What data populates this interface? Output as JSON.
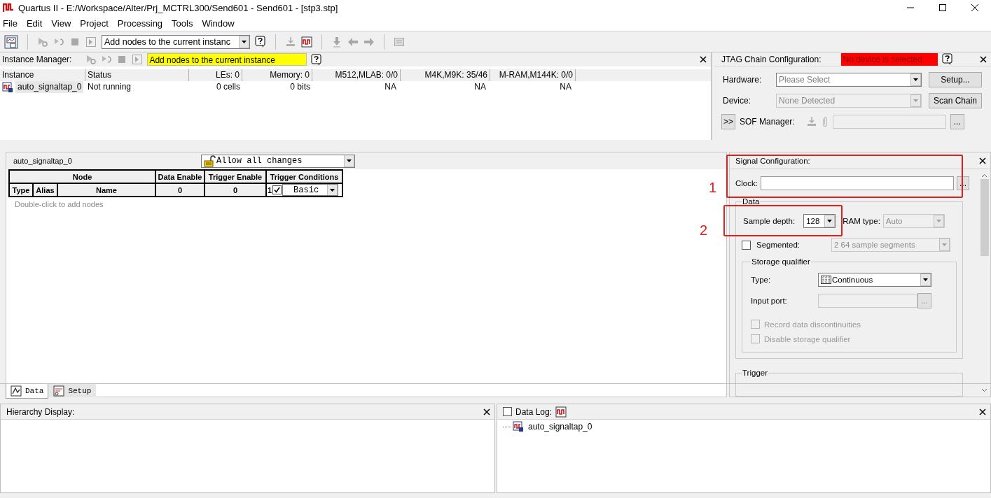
{
  "window": {
    "title": "Quartus II - E:/Workspace/Alter/Prj_MCTRL300/Send601 - Send601 - [stp3.stp]"
  },
  "menu": [
    "File",
    "Edit",
    "View",
    "Project",
    "Processing",
    "Tools",
    "Window"
  ],
  "toolbar": {
    "instance_combo": "Add nodes to the current instanc"
  },
  "instance_manager": {
    "label": "Instance Manager:",
    "status_message": "Add nodes to the current instance",
    "columns": [
      "Instance",
      "Status",
      "LEs: 0",
      "Memory: 0",
      "M512,MLAB: 0/0",
      "M4K,M9K: 35/46",
      "M-RAM,M144K: 0/0"
    ],
    "rows": [
      {
        "cells": [
          "auto_signaltap_0",
          "Not running",
          "0 cells",
          "0 bits",
          "NA",
          "NA",
          "NA"
        ],
        "selected": true
      }
    ]
  },
  "jtag": {
    "label": "JTAG Chain Configuration:",
    "status_message": "No device is selected",
    "hardware_label": "Hardware:",
    "hardware_value": "Please Select",
    "setup_button": "Setup...",
    "device_label": "Device:",
    "device_value": "None Detected",
    "scan_button": "Scan Chain",
    "expand_button": ">>",
    "sof_label": "SOF Manager:",
    "browse_button": "..."
  },
  "node_editor": {
    "instance": "auto_signaltap_0",
    "lock_mode": "Allow all changes",
    "node_header": "Node",
    "columns": [
      "Data Enable",
      "Trigger Enable",
      "Trigger Conditions"
    ],
    "sub_columns": [
      "Type",
      "Alias",
      "Name"
    ],
    "data_enable": "0",
    "trigger_enable": "0",
    "condition_index": "1",
    "condition_checked": true,
    "condition_type": "Basic",
    "hint": "Double-click to add nodes"
  },
  "signal_config": {
    "title": "Signal Configuration:",
    "clock_label": "Clock:",
    "clock_button": "...",
    "data_group": "Data",
    "sample_depth_label": "Sample depth:",
    "sample_depth": "128",
    "ram_type_label": "RAM type:",
    "ram_type": "Auto",
    "segmented_label": "Segmented:",
    "segmented_checked": false,
    "segments": "2  64 sample segments",
    "storage_qualifier": {
      "title": "Storage qualifier",
      "type_label": "Type:",
      "type_value": "Continuous",
      "input_port_label": "Input port:",
      "input_port_button": "...",
      "options": [
        {
          "label": "Record data discontinuities",
          "checked": false,
          "disabled": true
        },
        {
          "label": "Disable storage qualifier",
          "checked": false,
          "disabled": true
        }
      ]
    },
    "trigger_group": "Trigger"
  },
  "tabs": [
    {
      "label": "Data",
      "selected": true
    },
    {
      "label": "Setup",
      "selected": false
    }
  ],
  "hierarchy": {
    "title": "Hierarchy Display:"
  },
  "data_log": {
    "label": "Data Log:",
    "checked": false,
    "items": [
      "auto_signaltap_0"
    ]
  },
  "annotations": [
    {
      "label": "1"
    },
    {
      "label": "2"
    }
  ]
}
